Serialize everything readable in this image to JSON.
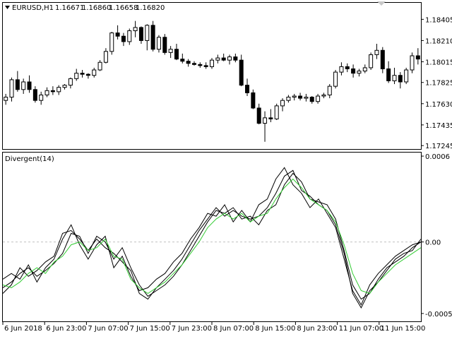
{
  "header": {
    "symbol": "EURUSD,H1",
    "open": "1.16671",
    "high": "1.16860",
    "low": "1.16658",
    "close": "1.16820"
  },
  "indicator": {
    "name": "Divergent(14)"
  },
  "colors": {
    "bull_fill": "#ffffff",
    "bear_fill": "#000000",
    "line_black": "#000000",
    "line_green": "#33cc33",
    "zero_line": "#c0c0c0"
  },
  "chart_data": [
    {
      "type": "candlestick",
      "title": "EURUSD,H1",
      "ylim": [
        1.1722,
        1.1855
      ],
      "y_ticks": [
        "1.18405",
        "1.18210",
        "1.18015",
        "1.17825",
        "1.17630",
        "1.17435",
        "1.17245"
      ],
      "y_tick_values": [
        1.18405,
        1.1821,
        1.18015,
        1.17825,
        1.1763,
        1.17435,
        1.17245
      ],
      "x_ticks": [
        "6 Jun 2018",
        "6 Jun 23:00",
        "7 Jun 07:00",
        "7 Jun 15:00",
        "7 Jun 23:00",
        "8 Jun 07:00",
        "8 Jun 15:00",
        "8 Jun 23:00",
        "11 Jun 07:00",
        "11 Jun 15:00"
      ],
      "candles": [
        [
          1.1766,
          1.1772,
          1.1762,
          1.1769
        ],
        [
          1.1769,
          1.1787,
          1.1765,
          1.1785
        ],
        [
          1.1785,
          1.1793,
          1.1774,
          1.1776
        ],
        [
          1.1776,
          1.1786,
          1.1772,
          1.1783
        ],
        [
          1.1783,
          1.1789,
          1.1773,
          1.1776
        ],
        [
          1.1776,
          1.1779,
          1.1764,
          1.1766
        ],
        [
          1.1766,
          1.1774,
          1.1762,
          1.1771
        ],
        [
          1.1771,
          1.1778,
          1.1769,
          1.1775
        ],
        [
          1.1775,
          1.1779,
          1.1771,
          1.1774
        ],
        [
          1.1774,
          1.178,
          1.1771,
          1.1778
        ],
        [
          1.1778,
          1.1781,
          1.1776,
          1.178
        ],
        [
          1.178,
          1.1787,
          1.1777,
          1.1786
        ],
        [
          1.1786,
          1.1795,
          1.1784,
          1.1791
        ],
        [
          1.1791,
          1.1794,
          1.1787,
          1.179
        ],
        [
          1.179,
          1.1791,
          1.1786,
          1.1789
        ],
        [
          1.1789,
          1.1796,
          1.1787,
          1.1794
        ],
        [
          1.1794,
          1.1803,
          1.1793,
          1.1801
        ],
        [
          1.1801,
          1.1814,
          1.18,
          1.1811
        ],
        [
          1.1811,
          1.1829,
          1.1808,
          1.1828
        ],
        [
          1.1828,
          1.1835,
          1.1822,
          1.1825
        ],
        [
          1.1825,
          1.1828,
          1.1816,
          1.182
        ],
        [
          1.182,
          1.1832,
          1.1817,
          1.183
        ],
        [
          1.183,
          1.1839,
          1.1824,
          1.1833
        ],
        [
          1.1833,
          1.1834,
          1.1818,
          1.1821
        ],
        [
          1.1821,
          1.1836,
          1.1812,
          1.1835
        ],
        [
          1.1835,
          1.1839,
          1.1811,
          1.1813
        ],
        [
          1.1813,
          1.1826,
          1.181,
          1.1824
        ],
        [
          1.1824,
          1.1827,
          1.1808,
          1.181
        ],
        [
          1.181,
          1.1816,
          1.1805,
          1.1813
        ],
        [
          1.1813,
          1.1818,
          1.1803,
          1.1804
        ],
        [
          1.1804,
          1.1809,
          1.18,
          1.1802
        ],
        [
          1.1802,
          1.1804,
          1.1797,
          1.18
        ],
        [
          1.18,
          1.1802,
          1.1798,
          1.1799
        ],
        [
          1.1799,
          1.1801,
          1.1796,
          1.1798
        ],
        [
          1.1798,
          1.1801,
          1.1795,
          1.1797
        ],
        [
          1.1797,
          1.1805,
          1.1795,
          1.1803
        ],
        [
          1.1803,
          1.1808,
          1.18,
          1.1805
        ],
        [
          1.1805,
          1.1809,
          1.1802,
          1.1803
        ],
        [
          1.1803,
          1.1808,
          1.1799,
          1.1806
        ],
        [
          1.1806,
          1.1809,
          1.1801,
          1.1803
        ],
        [
          1.1803,
          1.1808,
          1.1779,
          1.178
        ],
        [
          1.178,
          1.1786,
          1.177,
          1.1773
        ],
        [
          1.1773,
          1.1776,
          1.1758,
          1.1759
        ],
        [
          1.1759,
          1.1763,
          1.1744,
          1.1745
        ],
        [
          1.1745,
          1.1756,
          1.1728,
          1.175
        ],
        [
          1.175,
          1.1758,
          1.1746,
          1.1749
        ],
        [
          1.1749,
          1.1763,
          1.1748,
          1.1761
        ],
        [
          1.1761,
          1.1768,
          1.1756,
          1.1766
        ],
        [
          1.1766,
          1.1771,
          1.1764,
          1.1769
        ],
        [
          1.1769,
          1.1772,
          1.1766,
          1.177
        ],
        [
          1.177,
          1.1773,
          1.1766,
          1.1768
        ],
        [
          1.1768,
          1.1772,
          1.1765,
          1.1769
        ],
        [
          1.1769,
          1.177,
          1.1763,
          1.1765
        ],
        [
          1.1765,
          1.1772,
          1.1763,
          1.177
        ],
        [
          1.177,
          1.1773,
          1.1768,
          1.1771
        ],
        [
          1.1771,
          1.1781,
          1.1768,
          1.1779
        ],
        [
          1.1779,
          1.1794,
          1.1777,
          1.1792
        ],
        [
          1.1792,
          1.1801,
          1.1789,
          1.1797
        ],
        [
          1.1797,
          1.18,
          1.1792,
          1.1795
        ],
        [
          1.1795,
          1.1799,
          1.1787,
          1.1791
        ],
        [
          1.1791,
          1.1795,
          1.1788,
          1.1793
        ],
        [
          1.1793,
          1.1799,
          1.1791,
          1.1796
        ],
        [
          1.1796,
          1.181,
          1.1794,
          1.1808
        ],
        [
          1.1808,
          1.1818,
          1.1804,
          1.1812
        ],
        [
          1.1812,
          1.1815,
          1.1791,
          1.1795
        ],
        [
          1.1795,
          1.1802,
          1.1782,
          1.1784
        ],
        [
          1.1784,
          1.1796,
          1.1781,
          1.1789
        ],
        [
          1.1789,
          1.1792,
          1.1777,
          1.1783
        ],
        [
          1.1783,
          1.1796,
          1.1781,
          1.1794
        ],
        [
          1.1794,
          1.181,
          1.1791,
          1.1807
        ],
        [
          1.1807,
          1.1814,
          1.1799,
          1.1804
        ]
      ]
    },
    {
      "type": "line",
      "title": "Divergent(14)",
      "ylim": [
        -0.00055,
        0.00062
      ],
      "y_ticks": [
        "0.0006",
        "0.00",
        "-0.0005"
      ],
      "y_tick_values": [
        0.0006,
        0.0,
        -0.0005
      ],
      "zero_line": 0.0,
      "series": [
        {
          "color": "#000000",
          "values": [
            -0.00032,
            -0.00028,
            -0.00022,
            -0.00018,
            -0.00024,
            -0.0002,
            -0.00015,
            -8e-05,
            6e-05,
            4e-05,
            -8e-05,
            4e-05,
            0.0,
            -0.00012,
            -4e-05,
            -0.00018,
            -0.0003,
            -0.00038,
            -0.00034,
            -0.0003,
            -0.00024,
            -0.00016,
            -6e-05,
            4e-05,
            0.00014,
            0.00022,
            0.0002,
            0.00024,
            0.00016,
            0.00018,
            0.00012,
            0.00022,
            0.00026,
            0.0004,
            0.00048,
            0.00042,
            0.0003,
            0.00028,
            0.00026,
            0.00016,
            -6e-05,
            -0.0003,
            -0.0004,
            -0.00036,
            -0.00026,
            -0.00018,
            -0.00014,
            -0.0001,
            -4e-05,
            0.0
          ]
        },
        {
          "color": "#000000",
          "values": [
            -0.00026,
            -0.00022,
            -0.00026,
            -0.00016,
            -0.00028,
            -0.00018,
            -0.00012,
            2e-05,
            0.00012,
            -2e-05,
            -0.00012,
            -2e-05,
            4e-05,
            -0.00018,
            -0.0001,
            -0.00024,
            -0.00034,
            -0.00032,
            -0.00026,
            -0.00022,
            -0.00014,
            -8e-05,
            2e-05,
            0.0001,
            0.0002,
            0.00018,
            0.00026,
            0.00014,
            0.00022,
            0.00014,
            0.00026,
            0.0003,
            0.00044,
            0.00052,
            0.0004,
            0.00034,
            0.00024,
            0.0003,
            0.0002,
            0.0001,
            -0.00012,
            -0.00034,
            -0.00044,
            -0.0003,
            -0.00022,
            -0.00016,
            -0.0001,
            -6e-05,
            -2e-05,
            0.0
          ]
        },
        {
          "color": "#000000",
          "values": [
            -0.00036,
            -0.0003,
            -0.00018,
            -0.00024,
            -0.0002,
            -0.00014,
            -0.0001,
            6e-05,
            8e-05,
            2e-05,
            -6e-05,
            2e-05,
            -4e-05,
            -8e-05,
            -0.00014,
            -0.0002,
            -0.00036,
            -0.0004,
            -0.00032,
            -0.00026,
            -0.0002,
            -0.00012,
            -2e-05,
            8e-05,
            0.00016,
            0.00024,
            0.00018,
            0.00022,
            0.00018,
            0.00016,
            0.00018,
            0.00024,
            0.00034,
            0.00046,
            0.0005,
            0.00036,
            0.00032,
            0.00026,
            0.00022,
            0.00012,
            -8e-05,
            -0.00036,
            -0.00046,
            -0.00034,
            -0.00028,
            -0.0002,
            -0.00012,
            -8e-05,
            -6e-05,
            2e-05
          ]
        },
        {
          "color": "#33cc33",
          "values": [
            -0.0003,
            -0.00032,
            -0.00028,
            -0.00022,
            -0.00018,
            -0.00022,
            -0.00014,
            -0.0001,
            -2e-05,
            0.0,
            -6e-05,
            -4e-05,
            2e-05,
            -0.0001,
            -0.00012,
            -0.00026,
            -0.00032,
            -0.00036,
            -0.00032,
            -0.00028,
            -0.00022,
            -0.00016,
            -8e-05,
            0.0,
            0.0001,
            0.00016,
            0.0002,
            0.00016,
            0.0002,
            0.00014,
            0.00018,
            0.0002,
            0.0003,
            0.00038,
            0.00044,
            0.00038,
            0.0003,
            0.00026,
            0.00022,
            0.00014,
            -2e-05,
            -0.00022,
            -0.00034,
            -0.00036,
            -0.00028,
            -0.00022,
            -0.00016,
            -0.00012,
            -8e-05,
            -4e-05
          ]
        }
      ]
    }
  ]
}
